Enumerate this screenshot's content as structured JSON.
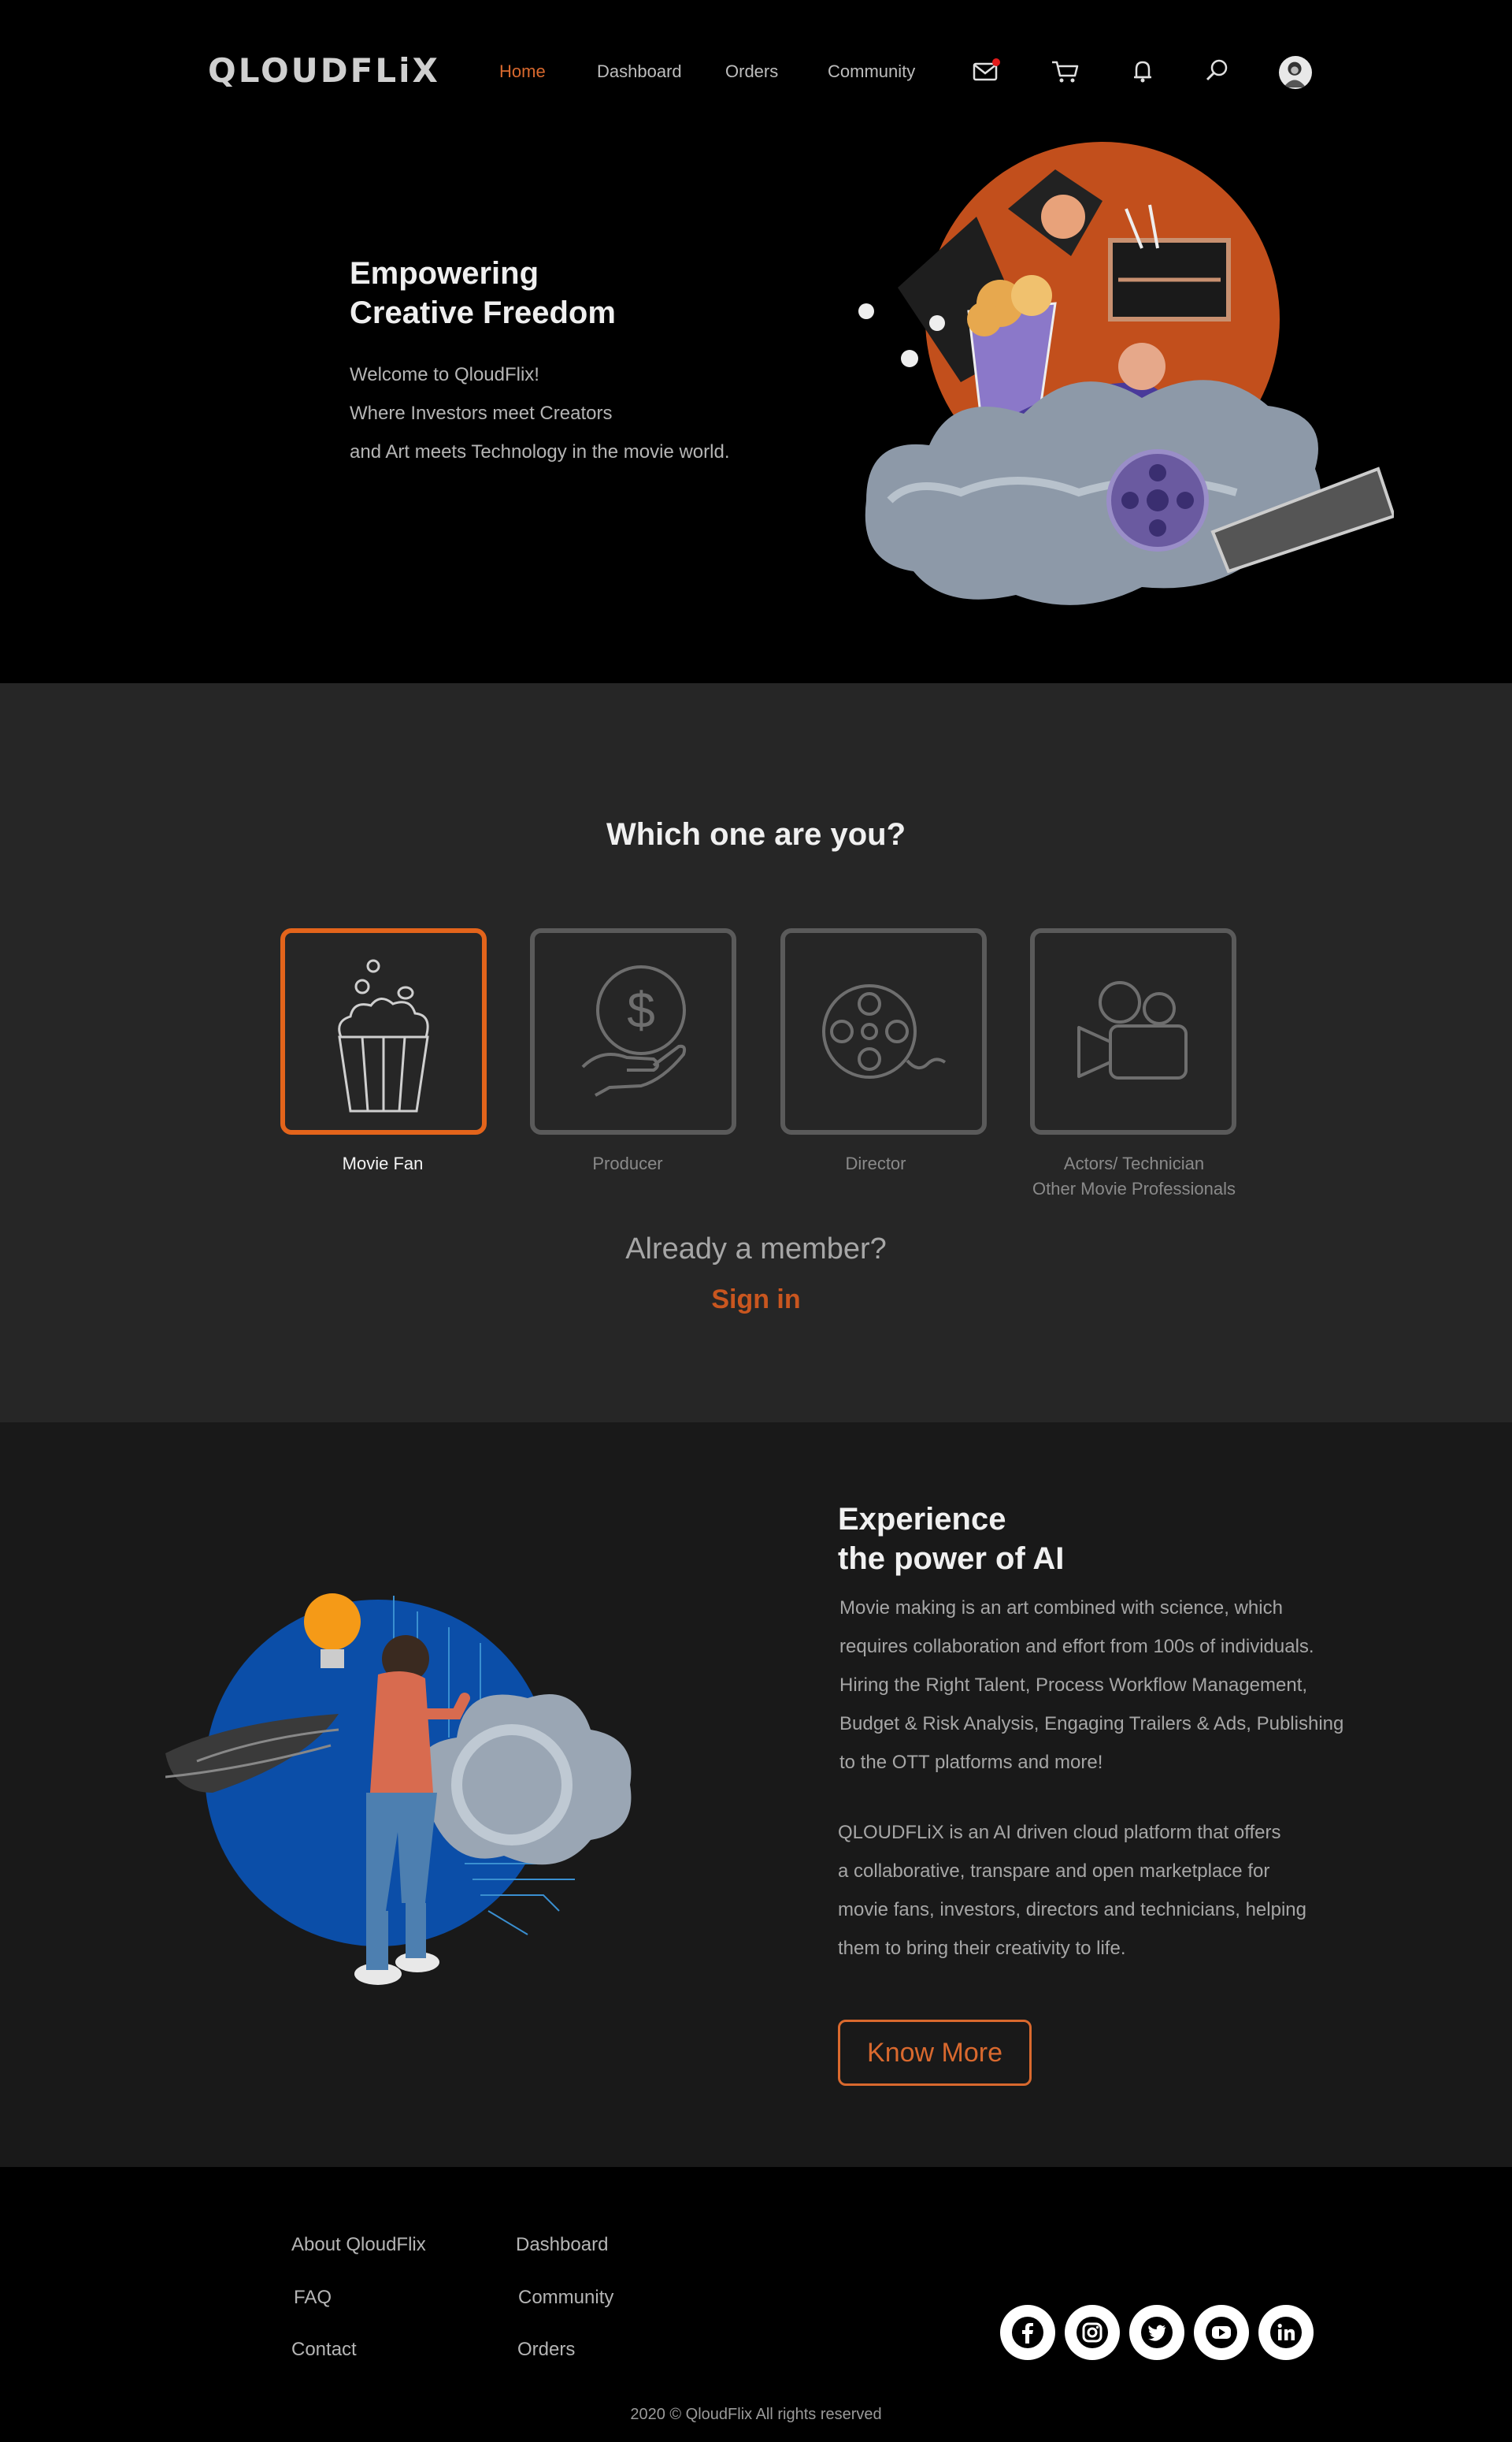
{
  "header": {
    "logo": "QLOUDFLiX",
    "nav": [
      {
        "label": "Home",
        "active": true
      },
      {
        "label": "Dashboard",
        "active": false
      },
      {
        "label": "Orders",
        "active": false
      },
      {
        "label": "Community",
        "active": false
      }
    ],
    "icons": [
      "mail-icon",
      "cart-icon",
      "bell-icon",
      "search-icon",
      "avatar"
    ]
  },
  "hero": {
    "title_line1": "Empowering",
    "title_line2": "Creative Freedom",
    "lines": [
      "Welcome to QloudFlix!",
      "Where Investors meet Creators",
      "and Art meets Technology in the movie world."
    ]
  },
  "roles": {
    "title": "Which one are you?",
    "items": [
      {
        "label": "Movie Fan",
        "icon": "popcorn-icon",
        "selected": true
      },
      {
        "label": "Producer",
        "icon": "money-hand-icon",
        "selected": false
      },
      {
        "label": "Director",
        "icon": "film-reel-icon",
        "selected": false
      },
      {
        "label": "Actors/ Technician",
        "label2": "Other Movie Professionals",
        "icon": "movie-camera-icon",
        "selected": false
      }
    ],
    "member_text": "Already a member?",
    "signin_label": "Sign in"
  },
  "ai": {
    "title_line1": "Experience",
    "title_line2": "the power of AI",
    "paragraph1": [
      "Movie making is an art combined with science, which",
      "requires collaboration and effort from 100s of individuals.",
      "Hiring the Right Talent, Process Workflow Management,",
      "Budget & Risk Analysis, Engaging Trailers & Ads, Publishing",
      "to the OTT platforms and more!"
    ],
    "paragraph2": [
      "QLOUDFLiX is an AI driven cloud platform that offers",
      "a collaborative, transpare and open marketplace for",
      "movie fans, investors, directors and technicians, helping",
      "them to bring their creativity to life."
    ],
    "button_label": "Know More"
  },
  "footer": {
    "col1": [
      "About QloudFlix",
      "FAQ",
      "Contact"
    ],
    "col2": [
      "Dashboard",
      "Community",
      "Orders"
    ],
    "social": [
      "facebook-icon",
      "instagram-icon",
      "twitter-icon",
      "youtube-icon",
      "linkedin-icon"
    ],
    "copyright": "2020 © QloudFlix  All rights reserved"
  },
  "colors": {
    "accent": "#e3641b",
    "background": "#000000",
    "section_dark": "#262626",
    "section_ai": "#191919"
  }
}
